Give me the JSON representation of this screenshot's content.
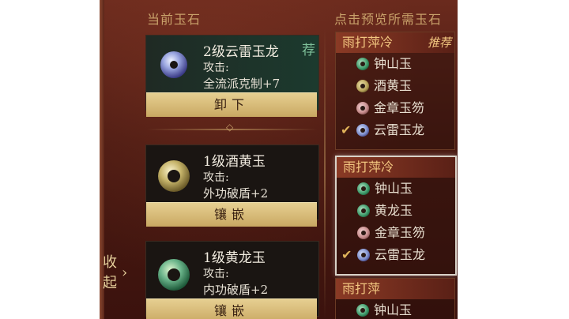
{
  "left_panel": {
    "title": "当前玉石",
    "collapse_label": "收起",
    "collapse_arrow": "›",
    "cards": [
      {
        "name": "2级云雷玉龙",
        "attr": "攻击:",
        "effect": "全流派克制+7",
        "tag": "荐",
        "button": "卸下",
        "icon": "blue-jade-icon"
      },
      {
        "name": "1级酒黄玉",
        "attr": "攻击:",
        "effect": "外功破盾+2",
        "tag": "",
        "button": "镶嵌",
        "icon": "yellow-jade-icon"
      },
      {
        "name": "1级黄龙玉",
        "attr": "攻击:",
        "effect": "内功破盾+2",
        "tag": "",
        "button": "镶嵌",
        "icon": "green-jade-icon"
      }
    ]
  },
  "right_panel": {
    "title": "点击预览所需玉石",
    "recipes": [
      {
        "title": "雨打萍冷",
        "badge": "推荐",
        "items": [
          {
            "label": "钟山玉",
            "color": "green",
            "checked": false
          },
          {
            "label": "酒黄玉",
            "color": "yellow",
            "checked": false
          },
          {
            "label": "金章玉笏",
            "color": "pink",
            "checked": false
          },
          {
            "label": "云雷玉龙",
            "color": "blue",
            "checked": true
          }
        ]
      },
      {
        "title": "雨打萍冷",
        "badge": "",
        "items": [
          {
            "label": "钟山玉",
            "color": "green",
            "checked": false
          },
          {
            "label": "黄龙玉",
            "color": "green",
            "checked": false
          },
          {
            "label": "金章玉笏",
            "color": "pink",
            "checked": false
          },
          {
            "label": "云雷玉龙",
            "color": "blue",
            "checked": true
          }
        ]
      },
      {
        "title": "雨打萍",
        "badge": "",
        "items": [
          {
            "label": "钟山玉",
            "color": "green",
            "checked": false
          }
        ]
      }
    ]
  },
  "colors": {
    "gold": "#e6cf91",
    "panel_dark": "#3b120d",
    "selected_border": "#d9d2c8"
  }
}
